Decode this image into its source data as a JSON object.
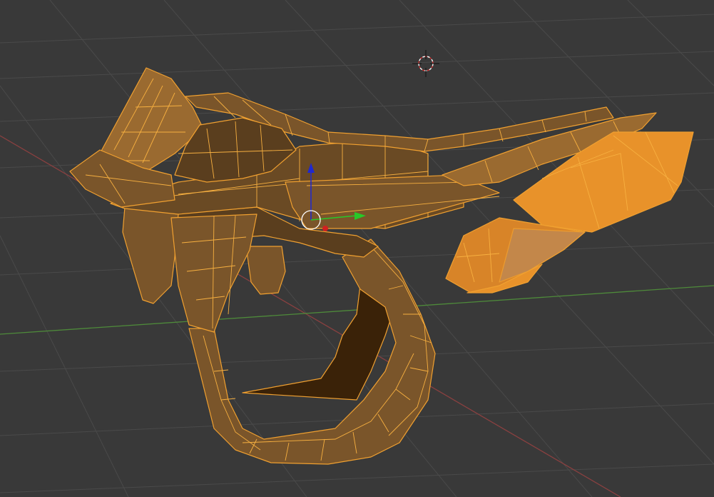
{
  "viewport": {
    "background": "#393939",
    "grid_color": "#4a4a4a",
    "x_axis_color": "#8a4040",
    "y_axis_color": "#4e8a3a"
  },
  "object": {
    "name_hint": "pistol-mesh",
    "selected": true,
    "selection_color": "#f0a030",
    "face_color_dark": "#5a3e1e",
    "face_color_mid": "#7a552a",
    "face_color_light": "#9a6a30",
    "face_color_bright": "#e8922a",
    "interior_color": "#3a2208"
  },
  "gizmo": {
    "x_color": "#d02020",
    "y_color": "#28c828",
    "z_color": "#2028d0"
  },
  "cursor_3d": {
    "icon": "3d-cursor-icon",
    "ring_color_a": "#ffffff",
    "ring_color_b": "#d03030"
  }
}
